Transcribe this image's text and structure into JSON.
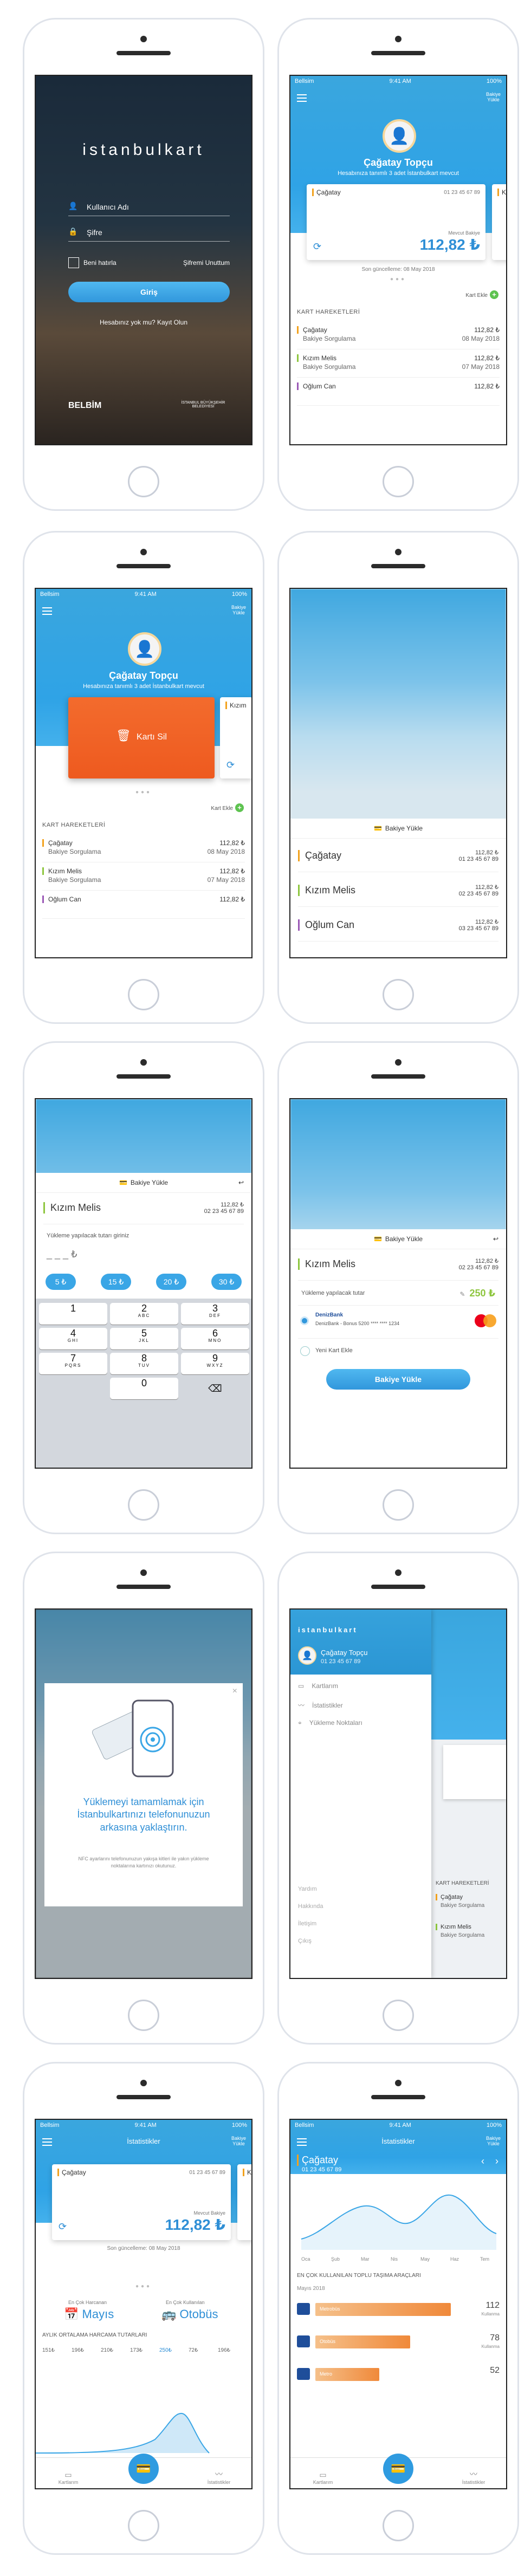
{
  "status": {
    "carrier": "Bellsim",
    "time": "9:41 AM",
    "battery": "100%"
  },
  "topright": {
    "label_line1": "Bakiye",
    "label_line2": "Yükle"
  },
  "login": {
    "brand": "istanbulkart",
    "username_placeholder": "Kullanıcı Adı",
    "password_placeholder": "Şifre",
    "remember": "Beni hatırla",
    "forgot": "Şifremi Unuttum",
    "submit": "Giriş",
    "register": "Hesabınız yok mu? Kayıt Olun",
    "logo_left": "BELBİM",
    "logo_right": "İSTANBUL BÜYÜKŞEHİR BELEDİYESİ"
  },
  "user": {
    "name": "Çağatay Topçu",
    "subtitle": "Hesabınıza tanımlı 3 adet İstanbulkart mevcut"
  },
  "card": {
    "name": "Çağatay",
    "number": "01 23 45 67 89",
    "balance_label": "Mevcut Bakiye",
    "balance": "112,82 ₺",
    "peek": "Kızım",
    "updated": "Son güncelleme: 08 May 2018",
    "delete": "Kartı Sil"
  },
  "add_card": "Kart Ekle",
  "transactions": {
    "title": "KART HAREKETLERİ",
    "rows": [
      {
        "name": "Çağatay",
        "type": "Bakiye Sorgulama",
        "amount": "112,82 ₺",
        "date": "08 May 2018"
      },
      {
        "name": "Kızım Melis",
        "type": "Bakiye Sorgulama",
        "amount": "112,82 ₺",
        "date": "07 May 2018"
      },
      {
        "name": "Oğlum Can",
        "type": "",
        "amount": "112,82 ₺",
        "date": ""
      }
    ]
  },
  "topup": {
    "title": "Bakiye Yükle",
    "people": [
      {
        "name": "Çağatay",
        "amount": "112,82 ₺",
        "number": "01 23 45 67 89",
        "color": "#f2a21e"
      },
      {
        "name": "Kızım Melis",
        "amount": "112,82 ₺",
        "number": "02 23 45 67 89",
        "color": "#8ec63f"
      },
      {
        "name": "Oğlum Can",
        "amount": "112,82 ₺",
        "number": "03 23 45 67 89",
        "color": "#9b59b6"
      }
    ],
    "enter_label": "Yükleme yapılacak tutarı giriniz",
    "placeholder": "_ _ _ ₺",
    "amounts": [
      "5 ₺",
      "15 ₺",
      "20 ₺",
      "30 ₺"
    ],
    "amount_label": "Yükleme yapılacak tutar",
    "amount_value": "250 ₺",
    "bank": "DenizBank",
    "bank_card": "DenizBank - Bonus 5200 **** **** 1234",
    "new_card": "Yeni Kart Ekle",
    "submit": "Bakiye Yükle"
  },
  "keypad": [
    {
      "n": "1",
      "s": ""
    },
    {
      "n": "2",
      "s": "ABC"
    },
    {
      "n": "3",
      "s": "DEF"
    },
    {
      "n": "4",
      "s": "GHI"
    },
    {
      "n": "5",
      "s": "JKL"
    },
    {
      "n": "6",
      "s": "MNO"
    },
    {
      "n": "7",
      "s": "PQRS"
    },
    {
      "n": "8",
      "s": "TUV"
    },
    {
      "n": "9",
      "s": "WXYZ"
    },
    {
      "n": "0",
      "s": ""
    }
  ],
  "nfc": {
    "title": "Yüklemeyi tamamlamak için İstanbulkartınızı telefonunuzun arkasına yaklaştırın.",
    "note": "NFC ayarlarını telefonunuzun yakışa kitleri ile yakın yükleme noktalarına kartınızı okutunuz."
  },
  "menu": {
    "brand": "istanbulkart",
    "user": "Çağatay Topçu",
    "number": "01 23 45 67 89",
    "items": [
      "Kartlarım",
      "İstatistikler",
      "Yükleme Noktaları"
    ],
    "footer": [
      "Yardım",
      "Hakkında",
      "İletişim",
      "Çıkış"
    ],
    "peek_title": "KART HAREKETLERİ",
    "peek_rows": [
      "Çağatay",
      "Bakiye Sorgulama",
      "Kızım Melis",
      "Bakiye Sorgulama"
    ]
  },
  "stats": {
    "title": "İstatistikler",
    "most_spent_label": "En Çok Harcanan",
    "most_spent": "Mayıs",
    "most_used_label": "En Çok Kullanılan",
    "most_used": "Otobüs",
    "monthly_title": "AYLIK ORTALAMA HARCAMA TUTARLARI",
    "monthly": [
      "151₺",
      "196₺",
      "210₺",
      "173₺",
      "250₺",
      "72₺",
      "196₺"
    ],
    "card_name": "Çağatay",
    "card_number": "01 23 45 67 89",
    "months": [
      "Oca",
      "Şub",
      "Mar",
      "Nis",
      "May",
      "Haz",
      "Tem"
    ],
    "usage_title": "EN ÇOK KULLANILAN TOPLU TAŞIMA ARAÇLARI",
    "usage_month": "Mayıs 2018",
    "usage": [
      {
        "name": "Metrobüs",
        "count": "112",
        "unit": "Kullanma",
        "fraction": 1.0
      },
      {
        "name": "Otobüs",
        "count": "78",
        "unit": "Kullanma",
        "fraction": 0.7
      },
      {
        "name": "Metro",
        "count": "52",
        "unit": "",
        "fraction": 0.47
      }
    ]
  },
  "tabs": {
    "left": "Kartlarım",
    "right": "İstatistikler"
  }
}
